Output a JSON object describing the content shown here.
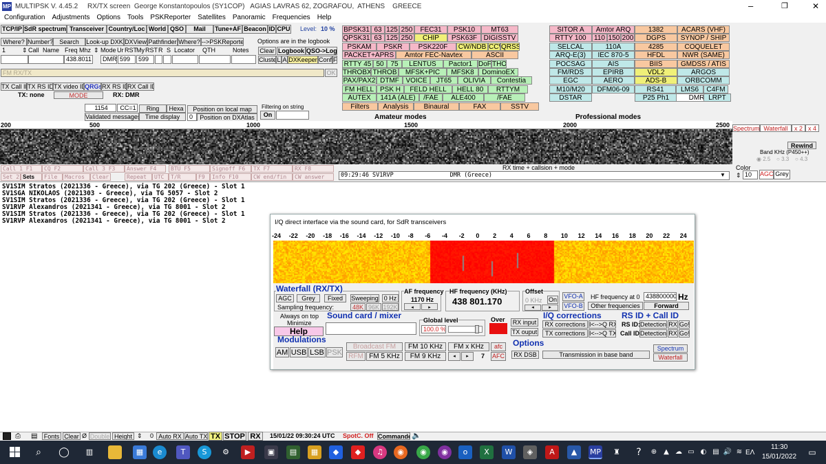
{
  "title_bar": {
    "title": "MULTIPSK V. 4.45.2     RX/TX screen  George Konstantopoulos (SY1COP)   AGIAS LAVRAS 62, ZOGRAFOU,  ATHENS    GREECE",
    "minimize": "–",
    "maximize": "❐",
    "close": "✕"
  },
  "menu": [
    "Configuration",
    "Adjustments",
    "Options",
    "Tools",
    "PSKReporter",
    "Satellites",
    "Panoramic",
    "Frequencies",
    "Help"
  ],
  "toolbar": {
    "buttons": [
      "TCP/IP",
      "SdR spectrum",
      "Transceiver",
      "Country/Loc",
      "World",
      "QSO",
      "Mail",
      "Tune+AF",
      "Beacon",
      "ID",
      "CPU"
    ],
    "level_label": "Level:",
    "level_value": "10 %"
  },
  "logrow": {
    "where": "Where?",
    "number": "Number?",
    "search": "Search",
    "lookup": "Look-up DXK",
    "dxview": "DXView",
    "pathfinder": "Pathfinder",
    "where2": "Where?",
    "pskrep": "-->PSKReporter",
    "opts": "Options are in the logbook",
    "clear": "Clear",
    "logbook": "Logbook",
    "qsolog": "QSO->Log",
    "cluster": "Cluster",
    "l": "L",
    "a": "A",
    "dxkeeper": "DXKeeper",
    "conf": "Conf",
    "f": "F"
  },
  "headers": {
    "n": "1",
    "call": "Call",
    "name": "Name",
    "freq": "Freq Mhz",
    "mode": "Mode",
    "ur": "Ur",
    "rst": "RST",
    "my": "My",
    "rst2": "RST",
    "r": "R",
    "s": "S",
    "locator": "Locator",
    "qth": "QTH",
    "notes": "Notes"
  },
  "fields": {
    "freq": "438.8011",
    "mode": "DMR",
    "rst": "599",
    "myrst": "599"
  },
  "fm": "FM RX/TX",
  "ok": "OK",
  "txrow": {
    "b1": "TX Call ID",
    "b2": "TX RS ID",
    "b3": "TX video ID",
    "b4": "QRGs",
    "b5": "RX RS ID",
    "b6": "RX Call ID",
    "tx": "TX: none",
    "mode_btn": "MODE",
    "rx": "RX: DMR"
  },
  "counters": {
    "count": "1154",
    "cc": "CC=1",
    "ring": "Ring",
    "hexa": "Hexa",
    "posmap": "Position on local map",
    "filter": "Filtering on string",
    "validated": "Validated messages",
    "timedisp": "Time display",
    "zero": "0",
    "dxatlas": "Position on DXAtlas",
    "on": "On"
  },
  "modes_amateur": [
    [
      "BPSK31",
      "63",
      "125",
      "250",
      "FEC31",
      "PSK10",
      "MT63"
    ],
    [
      "QPSK31",
      "63",
      "125",
      "250",
      "CHIP",
      "PSK63F",
      "DIGISSTV"
    ],
    [
      "PSKAM",
      "PSKR",
      "PSK220F",
      "CW/NDB",
      "CCW",
      "QRSS"
    ],
    [
      "PACKET+APRS",
      "Amtor FEC-Navtex",
      "ASCII"
    ],
    [
      "RTTY 45",
      "50",
      "75",
      "LENTUS",
      "Pactor1",
      "DoF",
      "THOR"
    ],
    [
      "THROBX",
      "THROB",
      "MFSK+PIC",
      "MFSK8",
      "DominoEX"
    ],
    [
      "PAX/PAX2",
      "DTMF",
      "VOICE",
      "JT65",
      "OLIVIA",
      "Contestia"
    ],
    [
      "FM HELL",
      "PSK H",
      "FELD HELL",
      "HELL 80",
      "RTTYM"
    ],
    [
      "AUTEX",
      "141A (ALE)",
      "/FAE",
      "ALE400",
      "/FAE"
    ],
    [
      "Filters",
      "Analysis",
      "Binaural",
      "FAX",
      "SSTV"
    ]
  ],
  "amateur_label": "Amateur modes",
  "modes_pro": [
    [
      "SITOR A",
      "Amtor ARQ",
      "1382",
      "ACARS (VHF)"
    ],
    [
      "RTTY 100",
      "110",
      "150",
      "200",
      "DGPS",
      "SYNOP / SHIP"
    ],
    [
      "SELCAL",
      "110A",
      "4285",
      "COQUELET"
    ],
    [
      "ARQ-E(3)",
      "IEC 870-5",
      "HFDL",
      "NWR (SAME)"
    ],
    [
      "POCSAG",
      "AIS",
      "BIIS",
      "GMDSS / ATIS"
    ],
    [
      "FM/RDS",
      "EPIRB",
      "VDL2",
      "ARGOS"
    ],
    [
      "EGC",
      "AERO",
      "ADS-B",
      "ORBCOMM"
    ],
    [
      "M10/M20",
      "DFM06-09",
      "RS41",
      "LMS6",
      "C4FM"
    ],
    [
      "DSTAR",
      "P25 Ph1",
      "DMR",
      "LRPT"
    ]
  ],
  "pro_label": "Professional modes",
  "scale": [
    "200",
    "500",
    "1000",
    "1500",
    "2000",
    "2500"
  ],
  "spec_btns": {
    "spectrum": "Spectrum",
    "waterfall": "Waterfall",
    "x2": "x 2",
    "x4": "x 4",
    "rewind": "Rewind",
    "band": "Band KHz (P450++)",
    "b1": "2.5",
    "b2": "3.3",
    "b3": "4.3"
  },
  "fkeys": [
    "Call 1  F1",
    "CQ          F2",
    "Call 3  F3",
    "Answer    F4",
    "BTU          F5",
    "Signoff F6",
    "TX               F7",
    "RX          F8"
  ],
  "fkeys2": [
    "Set 2",
    "Sets",
    "File",
    "Macros",
    "Clear",
    "Repeat",
    "UTC",
    "T/R",
    "F9",
    "Info    F10",
    "CW end/fin",
    "CW answer"
  ],
  "rxtime": "RX time + callsion + mode",
  "rxline": "09:29:46 SV1RVP                DMR (Greece)",
  "color": {
    "label": "Color",
    "value": "10",
    "agc": "AGC",
    "grey": "Grey"
  },
  "log": [
    "SV1SIM Stratos (2021336 - Greece), via TG 202 (Greece) - Slot 1",
    "SV1SGA NIKOLAOS (2021303 - Greece), via TG 5057 - Slot 2",
    "SV1SIM Stratos (2021336 - Greece), via TG 202 (Greece) - Slot 1",
    "SV1RVP Alexandros (2021341 - Greece), via TG 8001 - Slot 2",
    "SV1SIM Stratos (2021336 - Greece), via TG 202 (Greece) - Slot 1",
    "SV1RVP Alexandros (2021341 - Greece), via TG 8001 - Slot 2"
  ],
  "sdr": {
    "title": "I/Q direct interface via the sound card, for SdR transceivers",
    "scale": [
      "-24",
      "-22",
      "-20",
      "-18",
      "-16",
      "-14",
      "-12",
      "-10",
      "-8",
      "-6",
      "-4",
      "-2",
      "0",
      "2",
      "4",
      "6",
      "8",
      "10",
      "12",
      "14",
      "16",
      "18",
      "20",
      "22",
      "24"
    ],
    "wf_title": "Waterfall (RX/TX)",
    "agc": "AGC",
    "grey": "Grey",
    "fixed": "Fixed",
    "sweeping": "Sweeping",
    "zero": "0 Hz",
    "sampling": "Sampling frequency:",
    "s48": "48K",
    "s96": "96K",
    "s192": "192K",
    "af_label": "AF frequency",
    "af_value": "1170 Hz",
    "hf_label": "HF frequency (KHz)",
    "hf_value": "438 801.170",
    "offset_label": "Offset",
    "offset_value": "0 KHz",
    "on": "On",
    "vfoa": "VFO-A",
    "vfob": "VFO-B",
    "hf0_label": "HF frequency at 0",
    "hf0_value": "438800000",
    "hz": "Hz",
    "other": "Other frequencies",
    "forward": "Forward",
    "always": "Always on top",
    "minimize": "Minimize",
    "help": "Help",
    "sound": "Sound card / mixer",
    "global": "Global level",
    "global_val": "100.0 %",
    "over": "Over",
    "rxin": "RX input",
    "txout": "TX ouput",
    "iq": "I/Q corrections",
    "rxcorr": "RX corrections",
    "txcorr": "TX corrections",
    "rxq": "I<-->Q RX",
    "txq": "I<-->Q TX",
    "rsid": "RS ID + Call ID",
    "rsid_lbl": "RS ID:",
    "callid_lbl": "Call ID:",
    "detection": "Detection",
    "rx": "RX",
    "go": "Go!",
    "mods": "Modulations",
    "am": "AM",
    "usb": "USB",
    "lsb": "LSB",
    "psk": "PSK",
    "bfm": "Broadcast FM",
    "fm10": "FM 10 KHz",
    "fmx": "FM x KHz",
    "afc": "afc",
    "rfm": "RFM",
    "fm5": "FM 5 KHz",
    "fm9": "FM 9 KHz",
    "seven": "7",
    "afc2": "AFC",
    "options": "Options",
    "rxdsb": "RX DSB",
    "baseband": "Transmission in base band",
    "spectrum": "Spectrum",
    "waterfall": "Waterfall"
  },
  "statusbar": {
    "fonts": "Fonts",
    "clear": "Clear",
    "double": "Double",
    "height": "Height",
    "zero": "0",
    "autorx": "Auto RX",
    "autotx": "Auto TX",
    "tx": "TX",
    "stop": "STOP",
    "rx": "RX",
    "datetime": "15/01/22 09:30:24 UTC",
    "spotc": "SpotC. Off",
    "commander": "Commander"
  },
  "taskbar": {
    "lang": "EΛ",
    "time": "11:30",
    "date": "15/01/2022"
  }
}
